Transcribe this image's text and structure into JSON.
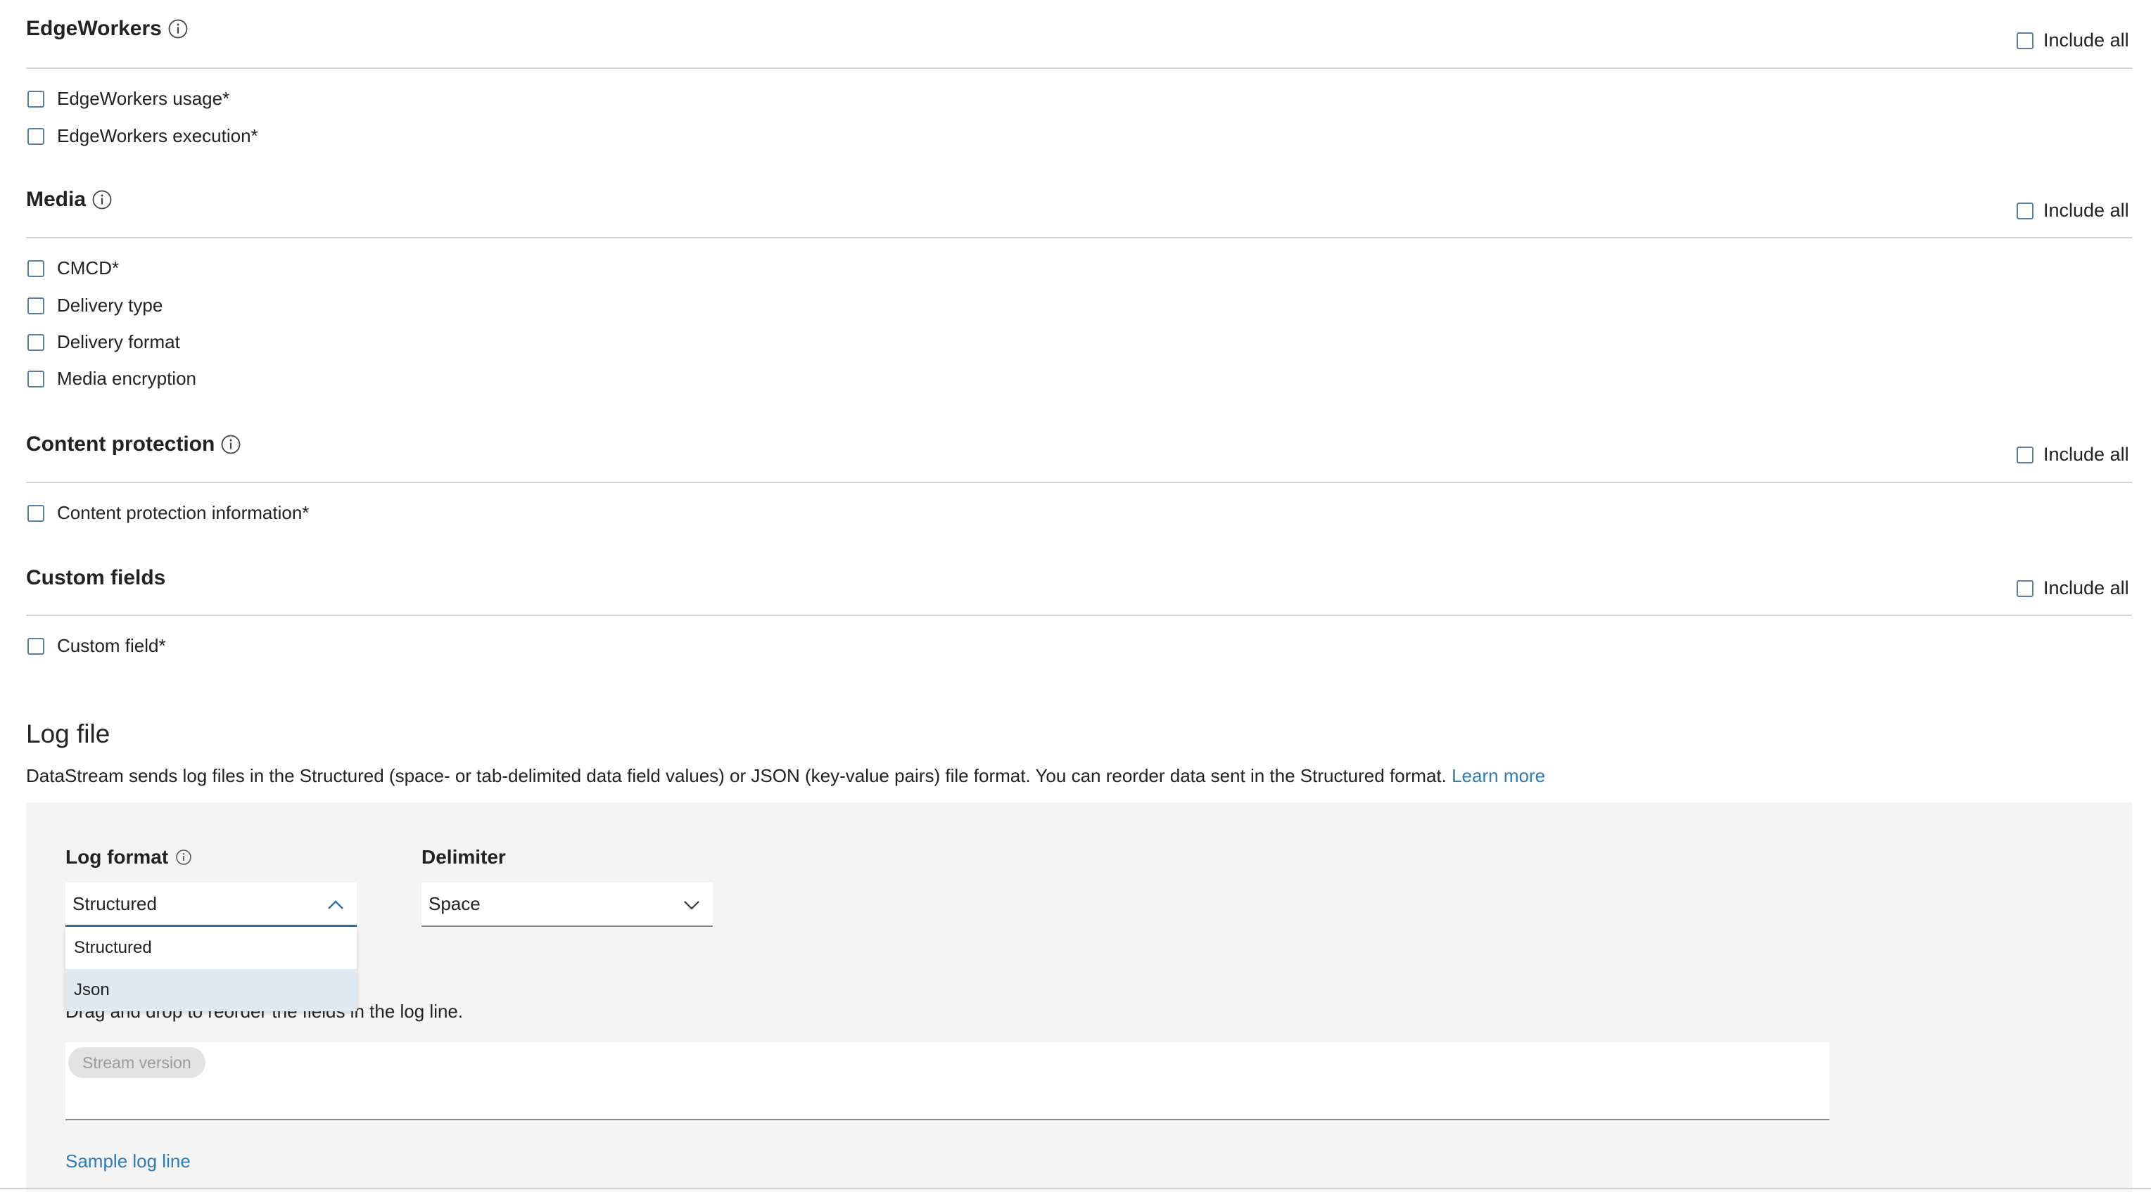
{
  "include_all_label": "Include all",
  "sections": [
    {
      "title": "EdgeWorkers",
      "fields": [
        "EdgeWorkers usage*",
        "EdgeWorkers execution*"
      ]
    },
    {
      "title": "Media",
      "fields": [
        "CMCD*",
        "Delivery type",
        "Delivery format",
        "Media encryption"
      ]
    },
    {
      "title": "Content protection",
      "fields": [
        "Content protection information*"
      ]
    },
    {
      "title": "Custom fields",
      "fields": [
        "Custom field*"
      ]
    }
  ],
  "log_file": {
    "title": "Log file",
    "description": "DataStream sends log files in the Structured (space- or tab-delimited data field values) or JSON (key-value pairs) file format. You can reorder data sent in the Structured format.",
    "learn_more": "Learn more",
    "log_format_label": "Log format",
    "log_format_value": "Structured",
    "log_format_options": [
      "Structured",
      "Json"
    ],
    "delimiter_label": "Delimiter",
    "delimiter_value": "Space",
    "drag_text": "Drag and drop to reorder the fields in the log line.",
    "chip": "Stream version",
    "sample_link": "Sample log line"
  },
  "colors": {
    "accent": "#2f7bb8",
    "panel": "#f4f4f4",
    "checkbox_border": "#5a7f9f",
    "option_highlight": "#dfe9f2"
  }
}
